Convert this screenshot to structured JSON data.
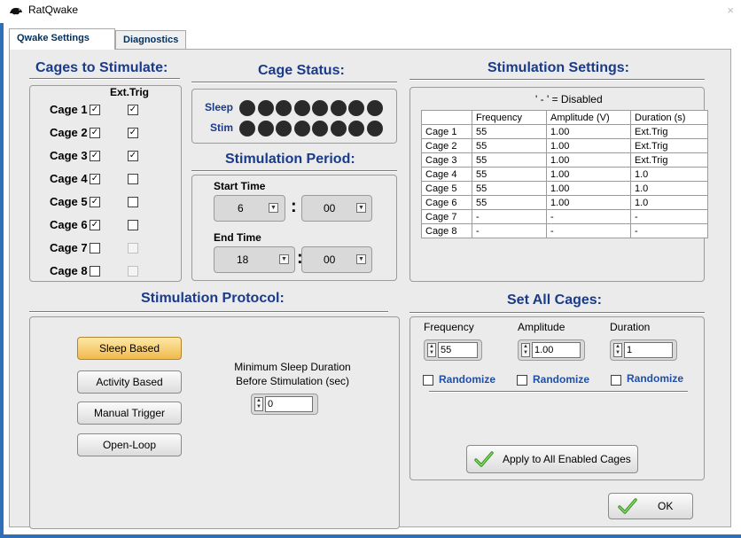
{
  "window": {
    "title": "RatQwake",
    "close_glyph": "×"
  },
  "tabs": [
    {
      "label": "Qwake Settings",
      "active": true
    },
    {
      "label": "Diagnostics",
      "active": false
    }
  ],
  "cages_to_stimulate": {
    "title": "Cages to Stimulate:",
    "ext_trig_header": "Ext.Trig",
    "cages": [
      {
        "label": "Cage 1",
        "enabled": true,
        "ext_trig": true
      },
      {
        "label": "Cage 2",
        "enabled": true,
        "ext_trig": true
      },
      {
        "label": "Cage 3",
        "enabled": true,
        "ext_trig": true
      },
      {
        "label": "Cage 4",
        "enabled": true,
        "ext_trig": false
      },
      {
        "label": "Cage 5",
        "enabled": true,
        "ext_trig": false
      },
      {
        "label": "Cage 6",
        "enabled": true,
        "ext_trig": false
      },
      {
        "label": "Cage 7",
        "enabled": false,
        "ext_trig": false
      },
      {
        "label": "Cage 8",
        "enabled": false,
        "ext_trig": false
      }
    ]
  },
  "cage_status": {
    "title": "Cage Status:",
    "sleep_label": "Sleep",
    "stim_label": "Stim",
    "indicator_count": 8
  },
  "stimulation_period": {
    "title": "Stimulation Period:",
    "start_label": "Start Time",
    "start_hour": "6",
    "start_minute": "00",
    "end_label": "End Time",
    "end_hour": "18",
    "end_minute": "00",
    "separator": ":"
  },
  "stimulation_settings": {
    "title": "Stimulation Settings:",
    "note": "' - ' = Disabled",
    "columns": [
      "",
      "Frequency",
      "Amplitude (V)",
      "Duration (s)"
    ],
    "rows": [
      [
        "Cage 1",
        "55",
        "1.00",
        "Ext.Trig"
      ],
      [
        "Cage 2",
        "55",
        "1.00",
        "Ext.Trig"
      ],
      [
        "Cage 3",
        "55",
        "1.00",
        "Ext.Trig"
      ],
      [
        "Cage 4",
        "55",
        "1.00",
        "1.0"
      ],
      [
        "Cage 5",
        "55",
        "1.00",
        "1.0"
      ],
      [
        "Cage 6",
        "55",
        "1.00",
        "1.0"
      ],
      [
        "Cage 7",
        "-",
        "-",
        "-"
      ],
      [
        "Cage 8",
        "-",
        "-",
        "-"
      ]
    ]
  },
  "stimulation_protocol": {
    "title": "Stimulation Protocol:",
    "buttons": [
      {
        "label": "Sleep Based",
        "active": true
      },
      {
        "label": "Activity Based",
        "active": false
      },
      {
        "label": "Manual Trigger",
        "active": false
      },
      {
        "label": "Open-Loop",
        "active": false
      }
    ],
    "min_sleep_label_line1": "Minimum Sleep Duration",
    "min_sleep_label_line2": "Before Stimulation (sec)",
    "min_sleep_value": "0"
  },
  "set_all_cages": {
    "title": "Set All Cages:",
    "frequency_label": "Frequency",
    "frequency_value": "55",
    "amplitude_label": "Amplitude",
    "amplitude_value": "1.00",
    "duration_label": "Duration",
    "duration_value": "1",
    "randomize_label": "Randomize",
    "apply_label": "Apply to All Enabled Cages"
  },
  "ok_label": "OK",
  "colors": {
    "section_title": "#1a3a8a",
    "randomize": "#1f4fa8",
    "active_button": "#f0b94d",
    "window_border": "#2f6fb5"
  },
  "icons": {
    "app": "rat-icon",
    "check": "green-check-icon"
  }
}
